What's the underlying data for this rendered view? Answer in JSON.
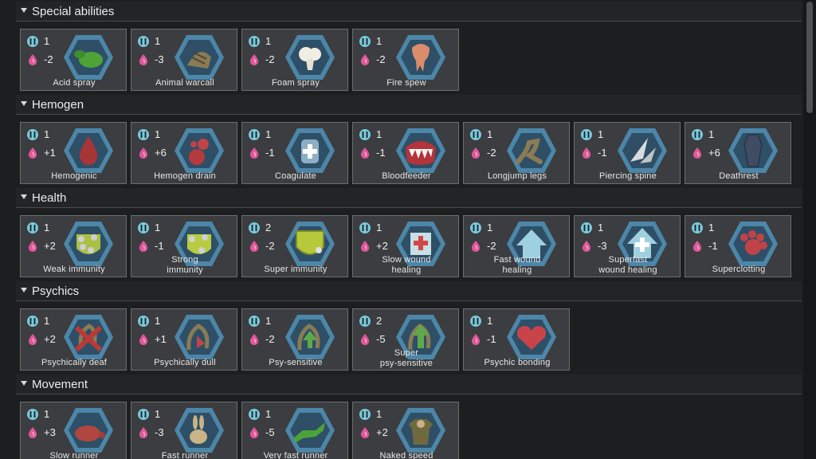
{
  "sections": [
    {
      "title": "Special abilities",
      "genes": [
        {
          "name": "Acid spray",
          "complexity": "1",
          "metabolism": "-2",
          "icon": "acid-spray-icon"
        },
        {
          "name": "Animal warcall",
          "complexity": "1",
          "metabolism": "-3",
          "icon": "animal-warcall-icon"
        },
        {
          "name": "Foam spray",
          "complexity": "1",
          "metabolism": "-2",
          "icon": "foam-spray-icon"
        },
        {
          "name": "Fire spew",
          "complexity": "1",
          "metabolism": "-2",
          "icon": "fire-spew-icon"
        }
      ]
    },
    {
      "title": "Hemogen",
      "genes": [
        {
          "name": "Hemogenic",
          "complexity": "1",
          "metabolism": "+1",
          "icon": "blood-drop-icon"
        },
        {
          "name": "Hemogen drain",
          "complexity": "1",
          "metabolism": "+6",
          "icon": "hemogen-drain-icon"
        },
        {
          "name": "Coagulate",
          "complexity": "1",
          "metabolism": "-1",
          "icon": "coagulate-hand-icon"
        },
        {
          "name": "Bloodfeeder",
          "complexity": "1",
          "metabolism": "-1",
          "icon": "fangs-icon"
        },
        {
          "name": "Longjump legs",
          "complexity": "1",
          "metabolism": "-2",
          "icon": "longjump-legs-icon"
        },
        {
          "name": "Piercing spine",
          "complexity": "1",
          "metabolism": "-1",
          "icon": "piercing-spine-icon"
        },
        {
          "name": "Deathrest",
          "complexity": "1",
          "metabolism": "+6",
          "icon": "coffin-icon"
        }
      ]
    },
    {
      "title": "Health",
      "genes": [
        {
          "name": "Weak immunity",
          "complexity": "1",
          "metabolism": "+2",
          "icon": "weak-immunity-icon"
        },
        {
          "name": "Strong immunity",
          "label_lines": [
            "Strong",
            "immunity"
          ],
          "complexity": "1",
          "metabolism": "-1",
          "icon": "strong-immunity-icon"
        },
        {
          "name": "Super immunity",
          "complexity": "2",
          "metabolism": "-2",
          "icon": "super-immunity-icon"
        },
        {
          "name": "Slow wound healing",
          "label_lines": [
            "Slow wound",
            "healing"
          ],
          "complexity": "1",
          "metabolism": "+2",
          "icon": "slow-healing-icon"
        },
        {
          "name": "Fast wound healing",
          "label_lines": [
            "Fast wound",
            "healing"
          ],
          "complexity": "1",
          "metabolism": "-2",
          "icon": "fast-healing-icon"
        },
        {
          "name": "Superfast wound healing",
          "label_lines": [
            "Superfast",
            "wound healing"
          ],
          "complexity": "1",
          "metabolism": "-3",
          "icon": "superfast-healing-icon"
        },
        {
          "name": "Superclotting",
          "complexity": "1",
          "metabolism": "-1",
          "icon": "superclotting-icon"
        }
      ]
    },
    {
      "title": "Psychics",
      "genes": [
        {
          "name": "Psychically deaf",
          "complexity": "1",
          "metabolism": "+2",
          "icon": "psychically-deaf-icon"
        },
        {
          "name": "Psychically dull",
          "complexity": "1",
          "metabolism": "+1",
          "icon": "psychically-dull-icon"
        },
        {
          "name": "Psy-sensitive",
          "complexity": "1",
          "metabolism": "-2",
          "icon": "psy-sensitive-icon"
        },
        {
          "name": "Super psy-sensitive",
          "label_lines": [
            "Super",
            "psy-sensitive"
          ],
          "complexity": "2",
          "metabolism": "-5",
          "icon": "super-psy-sensitive-icon"
        },
        {
          "name": "Psychic bonding",
          "complexity": "1",
          "metabolism": "-1",
          "icon": "heart-icon"
        }
      ]
    },
    {
      "title": "Movement",
      "genes": [
        {
          "name": "Slow runner",
          "complexity": "1",
          "metabolism": "+3",
          "icon": "turtle-icon"
        },
        {
          "name": "Fast runner",
          "complexity": "1",
          "metabolism": "-3",
          "icon": "rabbit-icon"
        },
        {
          "name": "Very fast runner",
          "complexity": "1",
          "metabolism": "-5",
          "icon": "running-animal-icon"
        },
        {
          "name": "Naked speed",
          "complexity": "1",
          "metabolism": "+2",
          "icon": "naked-speed-icon"
        }
      ]
    }
  ],
  "colors": {
    "complexity": "#79c9dc",
    "metabolism": "#e0579a",
    "hex_fill": "#4c86a8",
    "hex_inner": "#2e4f66"
  }
}
